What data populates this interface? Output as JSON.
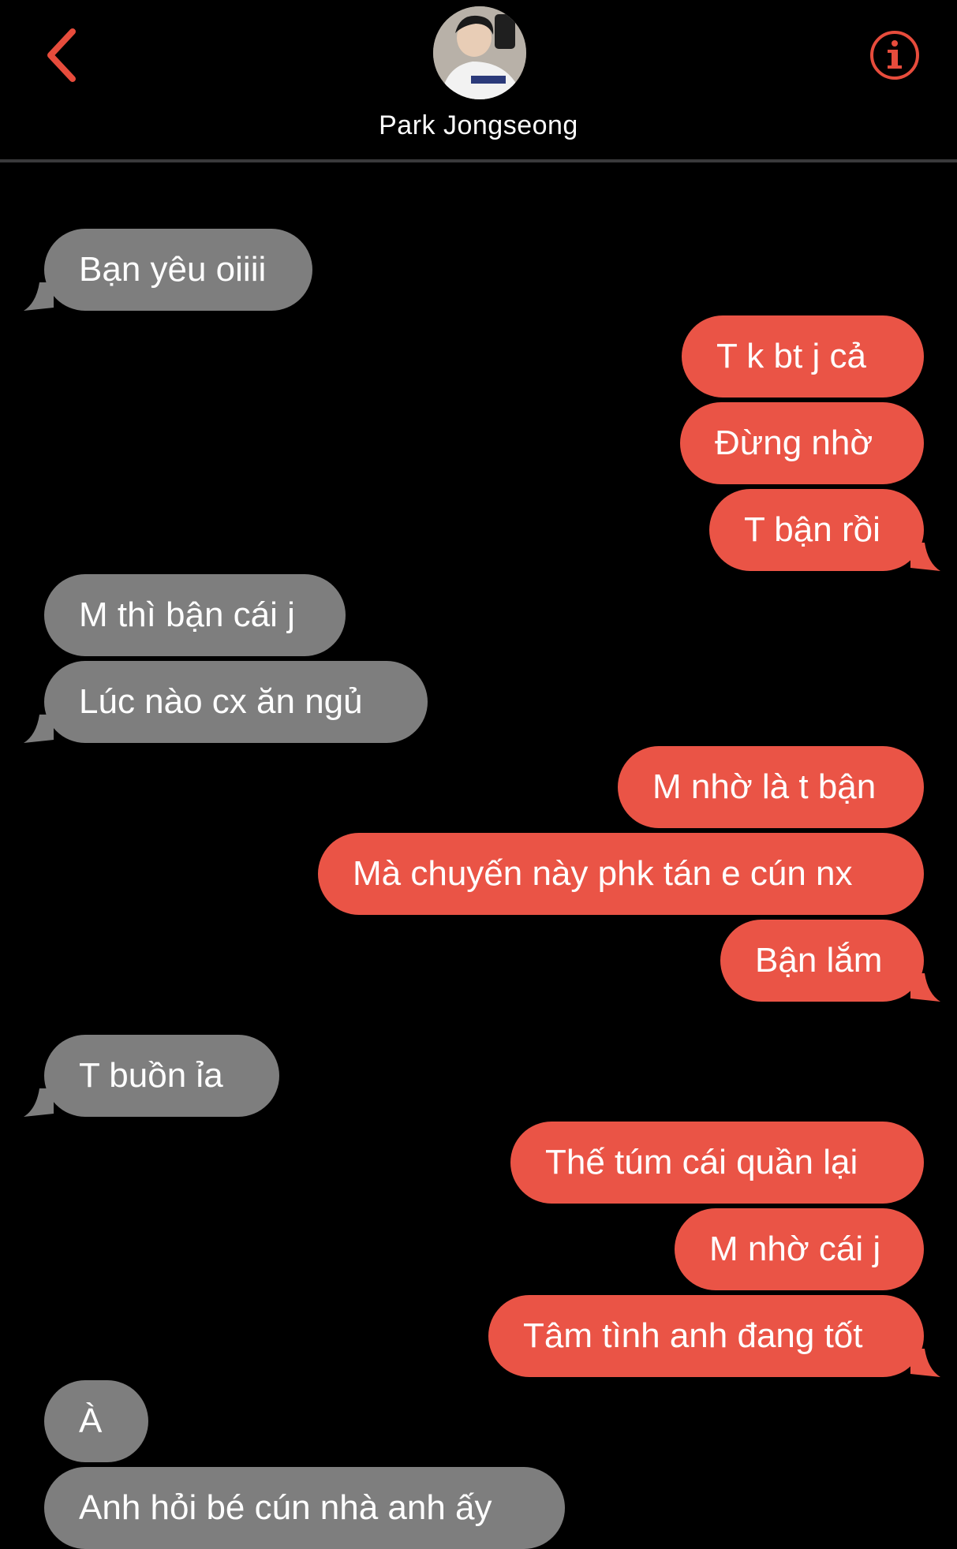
{
  "header": {
    "contact_name": "Park Jongseong"
  },
  "colors": {
    "accent": "#e74c3c",
    "sent_bubble": "#ea5446",
    "received_bubble": "#7e7e7e",
    "background": "#000000"
  },
  "icons": {
    "back": "chevron-left-icon",
    "info": "info-circle-icon",
    "avatar": "contact-avatar"
  },
  "messages": [
    {
      "direction": "received",
      "text": "Bạn yêu oiiii"
    },
    {
      "direction": "sent",
      "text": "T k bt j cả"
    },
    {
      "direction": "sent",
      "text": "Đừng nhờ"
    },
    {
      "direction": "sent",
      "text": "T bận rồi"
    },
    {
      "direction": "received",
      "text": "M thì bận cái j"
    },
    {
      "direction": "received",
      "text": "Lúc nào cx ăn ngủ"
    },
    {
      "direction": "sent",
      "text": "M nhờ là t bận"
    },
    {
      "direction": "sent",
      "text": "Mà chuyến này phk tán e cún nx"
    },
    {
      "direction": "sent",
      "text": "Bận lắm"
    },
    {
      "direction": "received",
      "text": "T buồn ỉa"
    },
    {
      "direction": "sent",
      "text": "Thế túm cái quần lại"
    },
    {
      "direction": "sent",
      "text": "M nhờ cái j"
    },
    {
      "direction": "sent",
      "text": "Tâm tình anh đang tốt"
    },
    {
      "direction": "received",
      "text": "À"
    },
    {
      "direction": "received",
      "text": "Anh hỏi bé cún nhà anh ấy"
    }
  ]
}
